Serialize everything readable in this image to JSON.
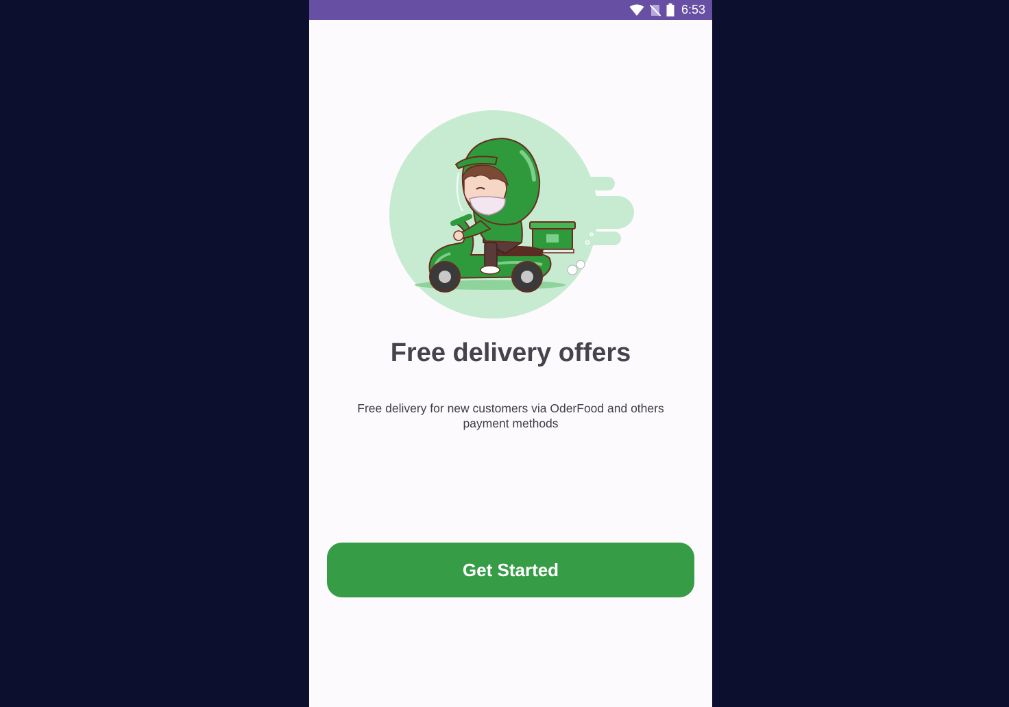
{
  "status_bar": {
    "time": "6:53",
    "icons": [
      "wifi-icon",
      "no-sim-icon",
      "battery-icon"
    ]
  },
  "onboarding": {
    "illustration": "delivery-scooter-illustration",
    "title": "Free delivery offers",
    "description": "Free delivery for new customers via OderFood and others payment methods",
    "primary_button_label": "Get Started"
  },
  "colors": {
    "status_bar": "#6750a4",
    "background": "#fdfafe",
    "primary_button": "#379c46",
    "title_text": "#45434b",
    "page_backdrop": "#0d0f2e"
  }
}
